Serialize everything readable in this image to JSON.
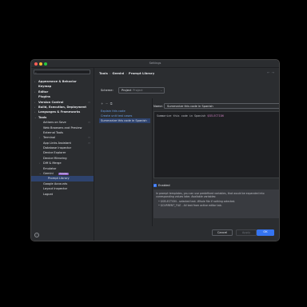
{
  "window": {
    "title": "Settings"
  },
  "search": {
    "placeholder": ""
  },
  "tree": [
    {
      "label": "Appearance & Behavior",
      "bold": true,
      "indent": 0,
      "chev": "›"
    },
    {
      "label": "Keymap",
      "bold": true,
      "indent": 0,
      "chev": ""
    },
    {
      "label": "Editor",
      "bold": true,
      "indent": 0,
      "chev": "›"
    },
    {
      "label": "Plugins",
      "bold": true,
      "indent": 0,
      "chev": ""
    },
    {
      "label": "Version Control",
      "bold": true,
      "indent": 0,
      "chev": "›",
      "opt": true
    },
    {
      "label": "Build, Execution, Deployment",
      "bold": true,
      "indent": 0,
      "chev": "›"
    },
    {
      "label": "Languages & Frameworks",
      "bold": true,
      "indent": 0,
      "chev": "›"
    },
    {
      "label": "Tools",
      "bold": true,
      "indent": 0,
      "chev": "⌄"
    },
    {
      "label": "Actions on Save",
      "indent": 1,
      "opt": true
    },
    {
      "label": "Web Browsers and Preview",
      "indent": 1
    },
    {
      "label": "External Tools",
      "indent": 1
    },
    {
      "label": "Terminal",
      "indent": 1,
      "chev": "›",
      "opt": true
    },
    {
      "label": "App Links Assistant",
      "indent": 1,
      "opt": true
    },
    {
      "label": "Database Inspector",
      "indent": 1
    },
    {
      "label": "Device Explorer",
      "indent": 1
    },
    {
      "label": "Device Mirroring",
      "indent": 1
    },
    {
      "label": "Diff & Merge",
      "indent": 1,
      "chev": "›"
    },
    {
      "label": "Emulator",
      "indent": 1
    },
    {
      "label": "Gemini",
      "indent": 1,
      "chev": "⌄",
      "badge": "Preview"
    },
    {
      "label": "Prompt Library",
      "indent": 2,
      "selected": true
    },
    {
      "label": "Google Accounts",
      "indent": 1
    },
    {
      "label": "Layout Inspector",
      "indent": 1
    },
    {
      "label": "Logcat",
      "indent": 1
    }
  ],
  "breadcrumb": {
    "a": "Tools",
    "b": "Gemini",
    "c": "Prompt Library",
    "sep": "›"
  },
  "scheme": {
    "label": "Scheme:",
    "value": "Project",
    "sub": "Project"
  },
  "toolbar": {
    "add": "+",
    "remove": "−",
    "copy": "⧉"
  },
  "prompts": [
    {
      "label": "Explain this code",
      "selected": false
    },
    {
      "label": "Create unit test cases",
      "selected": false
    },
    {
      "label": "Summarize this code in Spanish",
      "selected": true
    }
  ],
  "name": {
    "label": "Name:",
    "value": "Summarize this code in Spanish"
  },
  "editor": {
    "text_before": "Summarize this code in Spanish ",
    "variable": "$SELECTION"
  },
  "enabled": {
    "label": "Enabled",
    "checked": true
  },
  "info": {
    "text": "In prompt templates, you can use predefined variables, that would be expanded into corresponding values later. Available variables:",
    "items": [
      "$SELECTION - selected text. Whole file if nothing selected.",
      "$CURRENT_FILE - All text from active editor tab."
    ]
  },
  "buttons": {
    "cancel": "Cancel",
    "apply": "Apply",
    "ok": "OK"
  },
  "colors": {
    "accent": "#3574f0",
    "selection": "#2e436e",
    "badge": "#8a5cc4"
  }
}
